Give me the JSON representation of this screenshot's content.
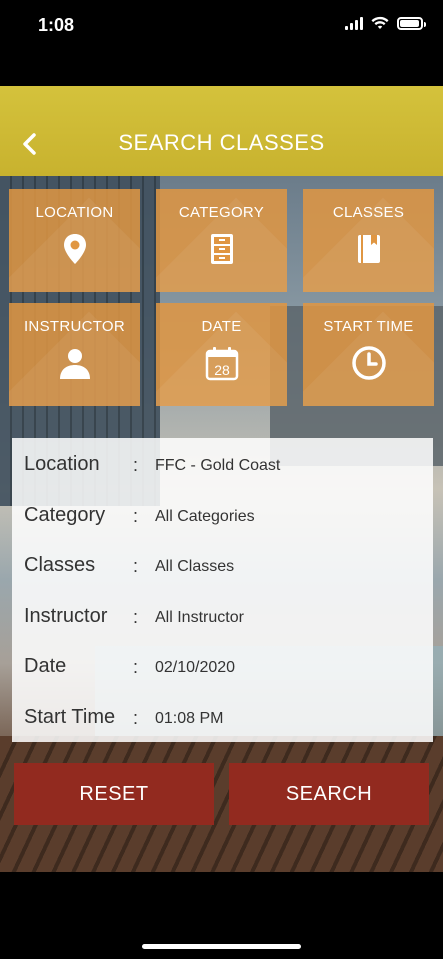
{
  "status_bar": {
    "time": "1:08"
  },
  "header": {
    "title": "SEARCH CLASSES"
  },
  "tiles": [
    {
      "label": "LOCATION",
      "icon": "location-pin-icon"
    },
    {
      "label": "CATEGORY",
      "icon": "file-cabinet-icon"
    },
    {
      "label": "CLASSES",
      "icon": "book-icon"
    },
    {
      "label": "INSTRUCTOR",
      "icon": "person-icon"
    },
    {
      "label": "DATE",
      "icon": "calendar-icon",
      "calendar_day": "28"
    },
    {
      "label": "START TIME",
      "icon": "clock-icon"
    }
  ],
  "form": {
    "rows": [
      {
        "label": "Location",
        "separator": ":",
        "value": "FFC - Gold Coast"
      },
      {
        "label": "Category",
        "separator": ":",
        "value": "All Categories"
      },
      {
        "label": "Classes",
        "separator": ":",
        "value": "All Classes"
      },
      {
        "label": "Instructor",
        "separator": ":",
        "value": "All Instructor"
      },
      {
        "label": "Date",
        "separator": ":",
        "value": "02/10/2020"
      },
      {
        "label": "Start Time",
        "separator": ":",
        "value": "01:08 PM"
      }
    ]
  },
  "buttons": {
    "reset": "RESET",
    "search": "SEARCH"
  },
  "colors": {
    "header": "#d4c23c",
    "tile": "#e09642",
    "button": "#922a1f"
  }
}
